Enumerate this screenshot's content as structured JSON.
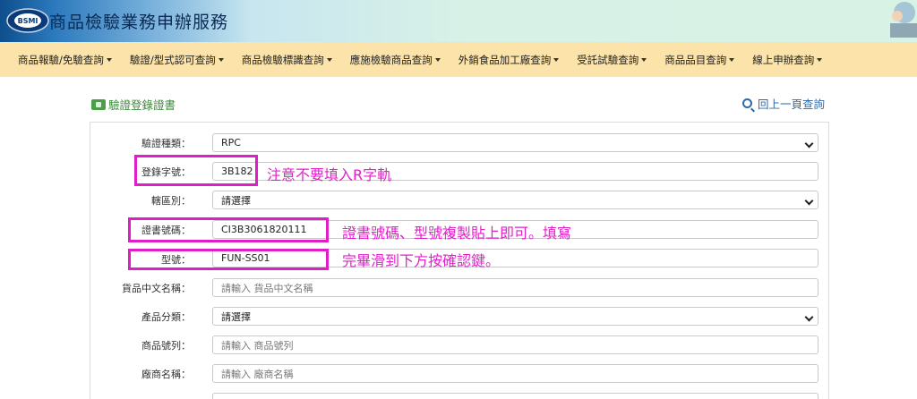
{
  "header": {
    "title": "商品檢驗業務申辦服務",
    "logo_text": "BSMI"
  },
  "nav": [
    {
      "label": "商品報驗/免驗查詢"
    },
    {
      "label": "驗證/型式認可查詢"
    },
    {
      "label": "商品檢驗標識查詢"
    },
    {
      "label": "應施檢驗商品查詢"
    },
    {
      "label": "外銷食品加工廠查詢"
    },
    {
      "label": "受託試驗查詢"
    },
    {
      "label": "商品品目查詢"
    },
    {
      "label": "線上申辦查詢"
    }
  ],
  "section": {
    "title": "驗證登錄證書",
    "back": "回上一頁查詢"
  },
  "form": {
    "cert_type": {
      "label": "驗證種類：",
      "value": "RPC"
    },
    "reg_no": {
      "label": "登錄字號：",
      "value": "3B182"
    },
    "district": {
      "label": "轄區別：",
      "value": "請選擇"
    },
    "cert_no": {
      "label": "證書號碼：",
      "value": "CI3B3061820111"
    },
    "model": {
      "label": "型號：",
      "value": "FUN-SS01"
    },
    "name_cn": {
      "label": "貨品中文名稱：",
      "placeholder": "請輸入 貨品中文名稱"
    },
    "category": {
      "label": "產品分類：",
      "value": "請選擇"
    },
    "serial": {
      "label": "商品號列：",
      "placeholder": "請輸入 商品號列"
    },
    "vendor": {
      "label": "廠商名稱：",
      "placeholder": "請輸入 廠商名稱"
    }
  },
  "notes": {
    "n1": "注意不要填入R字軌",
    "n2": "證書號碼、型號複製貼上即可。填寫",
    "n3": "完畢滑到下方按確認鍵。"
  },
  "colors": {
    "highlight": "#e01ec9",
    "nav_bg": "#fbe3a9",
    "link": "#2f6aa8"
  }
}
